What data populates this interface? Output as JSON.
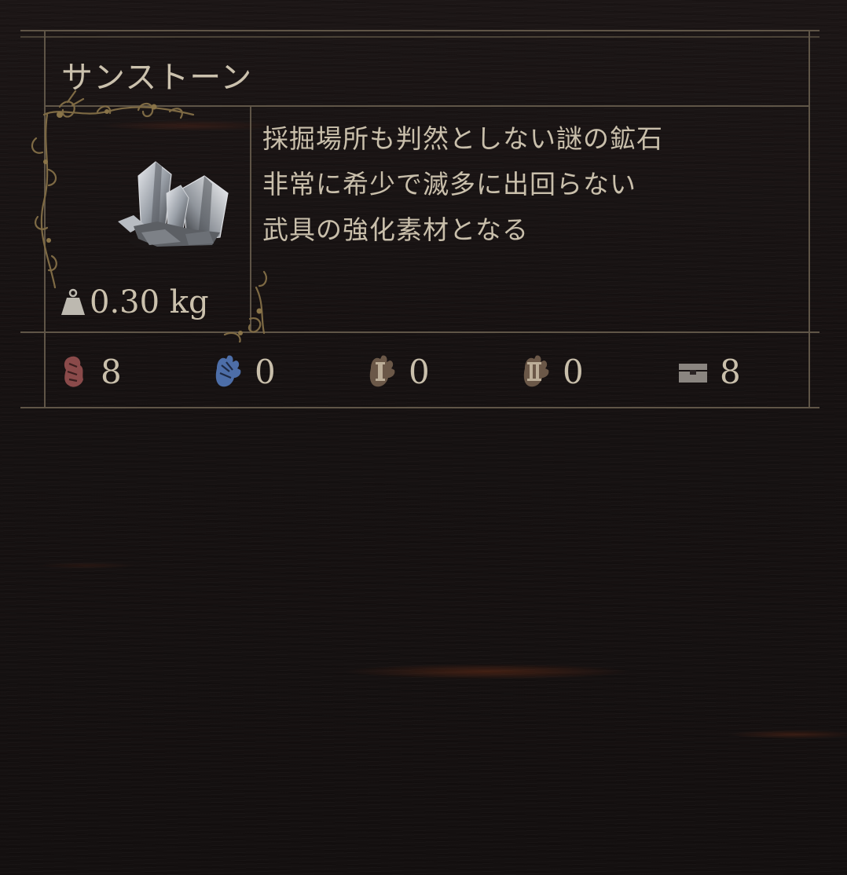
{
  "item": {
    "name": "サンストーン",
    "weight": "0.30 kg",
    "description": [
      "採掘場所も判然としない謎の鉱石",
      "非常に希少で滅多に出回らない",
      "武具の強化素材となる"
    ]
  },
  "stats": [
    {
      "icon": "red-hand-icon",
      "value": "8",
      "color": "#8a4a4a"
    },
    {
      "icon": "blue-hand-icon",
      "value": "0",
      "color": "#4d6ea8"
    },
    {
      "icon": "hand-rank-1-icon",
      "value": "0",
      "color": "#6b5848"
    },
    {
      "icon": "hand-rank-2-icon",
      "value": "0",
      "color": "#6b5848"
    },
    {
      "icon": "chest-icon",
      "value": "8",
      "color": "#8a8580"
    }
  ]
}
